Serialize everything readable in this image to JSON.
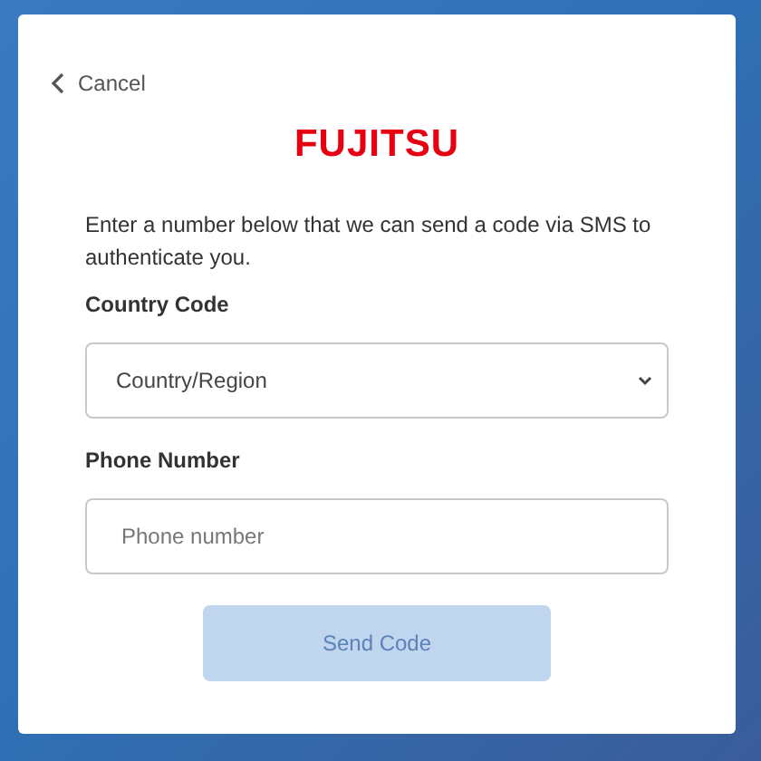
{
  "cancel": {
    "label": "Cancel"
  },
  "logo": {
    "text": "FUJITSU"
  },
  "instructions": "Enter a number below that we can send a code via SMS to authenticate you.",
  "country_code": {
    "label": "Country Code",
    "value": "Country/Region"
  },
  "phone_number": {
    "label": "Phone Number",
    "placeholder": "Phone number"
  },
  "send_button": {
    "label": "Send Code",
    "disabled": true
  }
}
